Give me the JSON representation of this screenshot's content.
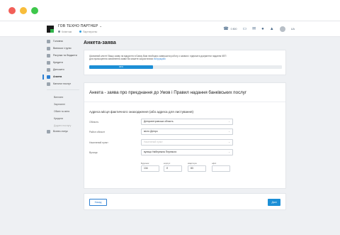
{
  "header": {
    "company": "ГОВ ТЕХНО ПАРТНЕР",
    "company_chevron": "⌄",
    "tags": [
      "Клієнтам",
      "Партнерство"
    ],
    "phone": "0 800",
    "lang": "UA",
    "icons": [
      "phone-icon",
      "chat-icon",
      "mail-icon",
      "user-icon",
      "bell-icon",
      "logout-icon"
    ]
  },
  "sidebar": {
    "items": [
      {
        "label": "Головна"
      },
      {
        "label": "Виписки і групи"
      },
      {
        "label": "Рахунки та бюджети"
      },
      {
        "label": "Кредити"
      },
      {
        "label": "Депозити"
      },
      {
        "label": "Анкета"
      },
      {
        "label": "Каталог послуг"
      }
    ],
    "subitems": [
      {
        "label": "Виплати"
      },
      {
        "label": "Зарплатні"
      },
      {
        "label": "Обмін та звіти"
      },
      {
        "label": "Кредити"
      },
      {
        "label": "Додати послугу"
      },
      {
        "label": "Бізнес-тонус"
      }
    ]
  },
  "page": {
    "title": "Анкета-заява"
  },
  "notice": {
    "line1": "Шановний клієнт! Вашу заяву на відкриття в Банку Вам необхідно завершити роботу з заявою і підписати документи надання КЕП",
    "line2": "Для прискорення заповнення заяви Ви можете скористатися",
    "link": "інструкцією",
    "progress": 33,
    "progress_label": "33%"
  },
  "form": {
    "title": "Анкета - заява про приєднання до Умов і Правил надання банківських послуг",
    "section": "Адреса місця фактичного знаходження (або адреса для листування)",
    "fields": [
      {
        "label": "Область",
        "value": "Дніпропетровська область",
        "placeholder": false
      },
      {
        "label": "Район області",
        "value": "місто Дніпро",
        "placeholder": false
      },
      {
        "label": "Населений пункт",
        "value": "Населений пункт",
        "placeholder": true
      },
      {
        "label": "Вулиця",
        "value": "вулиця Набережна Перемоги",
        "placeholder": false
      }
    ],
    "small_fields": [
      {
        "label": "Будинок",
        "value": "134"
      },
      {
        "label": "корпус",
        "value": "б"
      },
      {
        "label": "квартира",
        "value": "83"
      },
      {
        "label": "офіс",
        "value": ""
      }
    ]
  },
  "actions": {
    "back": "Назад",
    "next": "Далі"
  }
}
